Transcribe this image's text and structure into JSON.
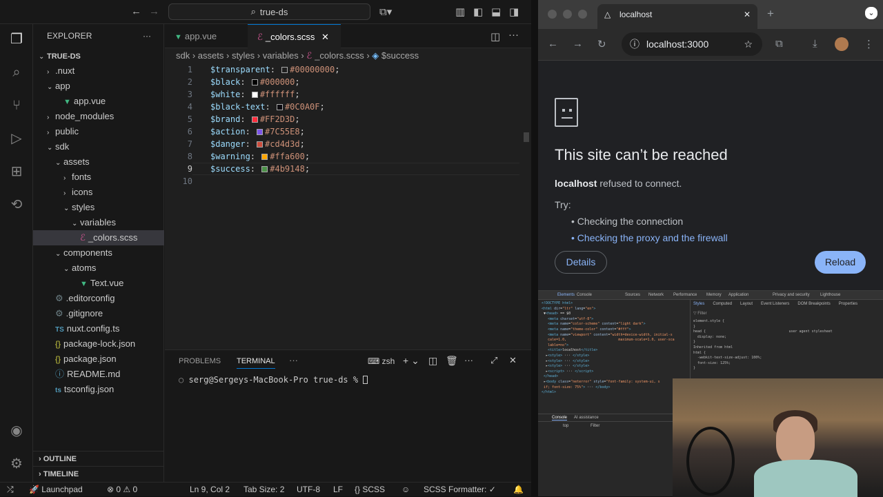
{
  "vscode": {
    "search": "true-ds",
    "explorer_title": "EXPLORER",
    "tree": [
      {
        "label": "TRUE-DS",
        "chev": "⌄",
        "icon": "",
        "bold": true
      },
      {
        "label": ".nuxt",
        "chev": "›",
        "icon": ""
      },
      {
        "label": "app",
        "chev": "⌄",
        "icon": ""
      },
      {
        "label": "app.vue",
        "chev": "",
        "icon": "vue"
      },
      {
        "label": "node_modules",
        "chev": "›",
        "icon": ""
      },
      {
        "label": "public",
        "chev": "›",
        "icon": ""
      },
      {
        "label": "sdk",
        "chev": "⌄",
        "icon": ""
      },
      {
        "label": "assets",
        "chev": "⌄",
        "icon": ""
      },
      {
        "label": "fonts",
        "chev": "›",
        "icon": ""
      },
      {
        "label": "icons",
        "chev": "›",
        "icon": ""
      },
      {
        "label": "styles",
        "chev": "⌄",
        "icon": ""
      },
      {
        "label": "variables",
        "chev": "⌄",
        "icon": ""
      },
      {
        "label": "_colors.scss",
        "chev": "",
        "icon": "scss",
        "selected": true
      },
      {
        "label": "components",
        "chev": "⌄",
        "icon": ""
      },
      {
        "label": "atoms",
        "chev": "⌄",
        "icon": ""
      },
      {
        "label": "Text.vue",
        "chev": "",
        "icon": "vue"
      },
      {
        "label": ".editorconfig",
        "chev": "",
        "icon": "gear"
      },
      {
        "label": ".gitignore",
        "chev": "",
        "icon": "gear"
      },
      {
        "label": "nuxt.config.ts",
        "chev": "",
        "icon": "ts"
      },
      {
        "label": "package-lock.json",
        "chev": "",
        "icon": "json"
      },
      {
        "label": "package.json",
        "chev": "",
        "icon": "json"
      },
      {
        "label": "README.md",
        "chev": "",
        "icon": "info"
      },
      {
        "label": "tsconfig.json",
        "chev": "",
        "icon": "tsj"
      }
    ],
    "outline": "OUTLINE",
    "timeline": "TIMELINE",
    "tabs": [
      {
        "label": "app.vue"
      },
      {
        "label": "_colors.scss"
      }
    ],
    "breadcrumb": [
      "sdk",
      "assets",
      "styles",
      "variables",
      "_colors.scss",
      "$success"
    ],
    "code_lines": [
      {
        "n": "1",
        "var": "$transparent",
        "val": "#00000000",
        "color": "#00000000"
      },
      {
        "n": "2",
        "var": "$black",
        "val": "#000000",
        "color": "#000000"
      },
      {
        "n": "3",
        "var": "$white",
        "val": "#ffffff",
        "color": "#ffffff"
      },
      {
        "n": "4",
        "var": "$black-text",
        "val": "#0C0A0F",
        "color": "#0C0A0F"
      },
      {
        "n": "5",
        "var": "$brand",
        "val": "#FF2D3D",
        "color": "#FF2D3D"
      },
      {
        "n": "6",
        "var": "$action",
        "val": "#7C55E8",
        "color": "#7C55E8"
      },
      {
        "n": "7",
        "var": "$danger",
        "val": "#cd4d3d",
        "color": "#cd4d3d"
      },
      {
        "n": "8",
        "var": "$warning",
        "val": "#ffa600",
        "color": "#ffa600"
      },
      {
        "n": "9",
        "var": "$success",
        "val": "#4b9148",
        "color": "#4b9148"
      },
      {
        "n": "10",
        "var": "",
        "val": "",
        "color": ""
      }
    ],
    "panel_tabs": [
      "PROBLEMS",
      "TERMINAL"
    ],
    "shell": "zsh",
    "terminal_prompt": "serg@Sergeys-MacBook-Pro true-ds % ",
    "status": {
      "launchpad": "Launchpad",
      "errors": "0",
      "warnings": "0",
      "position": "Ln 9, Col 2",
      "tab_size": "Tab Size: 2",
      "encoding": "UTF-8",
      "eol": "LF",
      "language": "SCSS",
      "formatter": "SCSS Formatter: ✓"
    }
  },
  "chrome": {
    "tab_title": "localhost",
    "url": "localhost:3000",
    "error_title": "This site can’t be reached",
    "host": "localhost",
    "refused": " refused to connect.",
    "try": "Try:",
    "suggestions": [
      "Checking the connection",
      "Checking the proxy and the firewall"
    ],
    "details": "Details",
    "reload": "Reload",
    "devtools_tabs": [
      "Elements",
      "Console",
      "Sources",
      "Network",
      "Performance",
      "Memory",
      "Application",
      "Privacy and security",
      "Lighthouse"
    ],
    "styles_tabs": [
      "Styles",
      "Computed",
      "Layout",
      "Event Listeners",
      "DOM Breakpoints",
      "Properties"
    ],
    "console_tabs": [
      "Console",
      "AI assistance"
    ],
    "console_top": "top",
    "console_filter": "Filter"
  }
}
